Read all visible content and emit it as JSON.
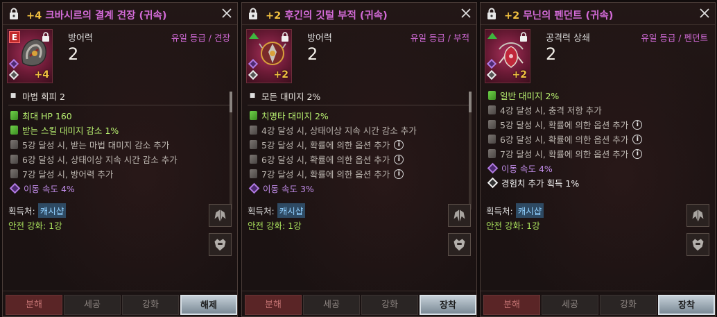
{
  "panels": [
    {
      "title_plus": "+4",
      "title_name": "크바시르의 결계 견장 (귀속)",
      "badge": "E",
      "level": "+4",
      "stat_name": "방어력",
      "stat_value": "2",
      "grade": "유일 등급 / 견장",
      "effects": [
        {
          "icon": "bullet",
          "text": "마법 회피 2"
        },
        {
          "icon": "green",
          "text": "최대 HP 160"
        },
        {
          "icon": "green",
          "text": "받는 스킬 대미지 감소 1%"
        },
        {
          "icon": "grey",
          "text": "5강 달성 시, 받는 마법 대미지 감소 추가"
        },
        {
          "icon": "grey",
          "text": "6강 달성 시, 상태이상 지속 시간 감소 추가"
        },
        {
          "icon": "grey",
          "text": "7강 달성 시, 방어력 추가"
        },
        {
          "icon": "purple",
          "text": "이동 속도 4%"
        }
      ],
      "acquire_label": "획득처:",
      "acquire_value": "캐시샵",
      "safe_enhance": "안전 강화: 1강",
      "buttons": [
        "분해",
        "세공",
        "강화",
        "해제"
      ]
    },
    {
      "title_plus": "+2",
      "title_name": "후긴의 깃털 부적 (귀속)",
      "level": "+2",
      "stat_name": "방어력",
      "stat_value": "2",
      "grade": "유일 등급 / 부적",
      "effects": [
        {
          "icon": "bullet",
          "text": "모든 대미지 2%"
        },
        {
          "icon": "green",
          "text": "치명타 대미지 2%"
        },
        {
          "icon": "grey",
          "text": "4강 달성 시, 상태이상 지속 시간 감소 추가"
        },
        {
          "icon": "grey",
          "text": "5강 달성 시, 확률에 의한 옵션 추가",
          "info": true
        },
        {
          "icon": "grey",
          "text": "6강 달성 시, 확률에 의한 옵션 추가",
          "info": true
        },
        {
          "icon": "grey",
          "text": "7강 달성 시, 확률에 의한 옵션 추가",
          "info": true
        },
        {
          "icon": "purple",
          "text": "이동 속도 3%"
        }
      ],
      "acquire_label": "획득처:",
      "acquire_value": "캐시샵",
      "safe_enhance": "안전 강화: 1강",
      "buttons": [
        "분해",
        "세공",
        "강화",
        "장착"
      ]
    },
    {
      "title_plus": "+2",
      "title_name": "무닌의 펜던트 (귀속)",
      "level": "+2",
      "stat_name": "공격력 상쇄",
      "stat_value": "2",
      "grade": "유일 등급 / 펜던트",
      "effects": [
        {
          "icon": "green",
          "text": "일반 대미지 2%"
        },
        {
          "icon": "grey",
          "text": "4강 달성 시, 충격 저항 추가"
        },
        {
          "icon": "grey",
          "text": "5강 달성 시, 확률에 의한 옵션 추가",
          "info": true
        },
        {
          "icon": "grey",
          "text": "6강 달성 시, 확률에 의한 옵션 추가",
          "info": true
        },
        {
          "icon": "grey",
          "text": "7강 달성 시, 확률에 의한 옵션 추가",
          "info": true
        },
        {
          "icon": "purple",
          "text": "이동 속도 4%"
        },
        {
          "icon": "white",
          "text": "경험치 추가 획득 1%"
        }
      ],
      "acquire_label": "획득처:",
      "acquire_value": "캐시샵",
      "safe_enhance": "안전 강화: 1강",
      "buttons": [
        "분해",
        "세공",
        "강화",
        "장착"
      ]
    }
  ],
  "info_glyph": "i",
  "colors": {
    "title": "#d36bd8",
    "plus": "#f0c040",
    "green": "#b8f070",
    "purple": "#c08ce8",
    "safe": "#a9e05c"
  }
}
